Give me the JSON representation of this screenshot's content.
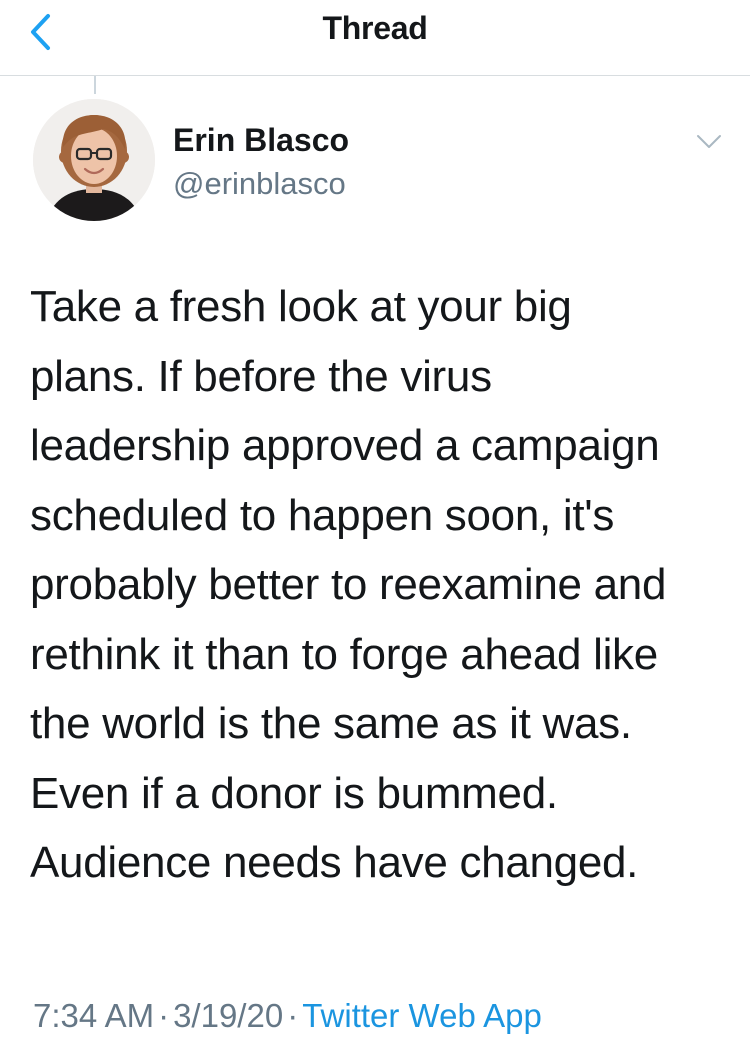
{
  "header": {
    "title": "Thread",
    "back_icon": "chevron-left-icon"
  },
  "tweet": {
    "author": {
      "name": "Erin Blasco",
      "handle": "@erinblasco",
      "avatar": "profile-photo"
    },
    "text_lines": [
      "Take a fresh look at your big",
      "plans. If before the virus",
      "leadership approved a campaign",
      "scheduled to happen soon, it's",
      "probably better to reexamine and",
      "rethink it than to forge ahead like",
      "the world is the same as it was.",
      "Even if a donor is bummed.",
      "Audience needs have changed."
    ],
    "meta": {
      "time": "7:34 AM",
      "separator": "·",
      "date": "3/19/20",
      "source": "Twitter Web App"
    }
  },
  "colors": {
    "accent": "#1b95e0",
    "text": "#14171a",
    "secondary": "#657786",
    "divider": "#d8dde0"
  }
}
